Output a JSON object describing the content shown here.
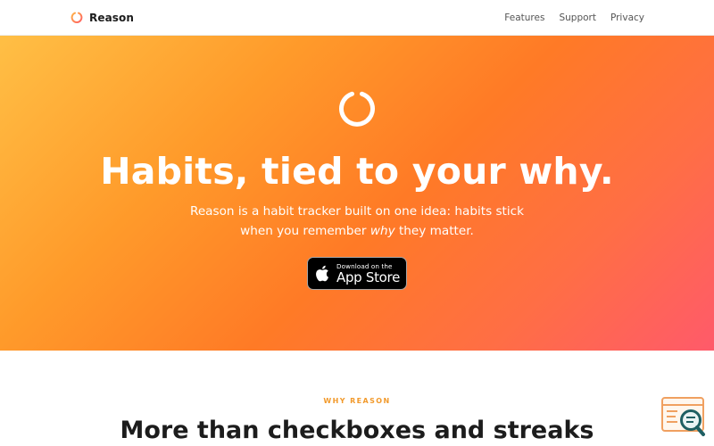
{
  "nav": {
    "brand_name": "Reason",
    "links": [
      {
        "label": "Features"
      },
      {
        "label": "Support"
      },
      {
        "label": "Privacy"
      }
    ]
  },
  "hero": {
    "title": "Habits, tied to your why.",
    "subtitle_line1": "Reason is a habit tracker built on one idea: habits stick",
    "subtitle_line2_pre": "when you remember ",
    "subtitle_line2_em": "why",
    "subtitle_line2_post": " they matter.",
    "app_store": {
      "small_label": "Download on the",
      "big_label": "App Store"
    }
  },
  "why": {
    "eyebrow": "WHY REASON",
    "title": "More than checkboxes and streaks"
  },
  "icons": {
    "brand": "ring-logo-icon",
    "hero": "ring-logo-icon",
    "store": "apple-logo-icon",
    "widget": "page-inspect-icon"
  },
  "colors": {
    "brand_ring_start": "#ffb347",
    "brand_ring_end": "#ff5e62",
    "hero_gradient_start": "#ffbf45",
    "hero_gradient_end": "#ff5a6a",
    "eyebrow": "#f29a2c",
    "title_text": "#1c1c1c"
  }
}
